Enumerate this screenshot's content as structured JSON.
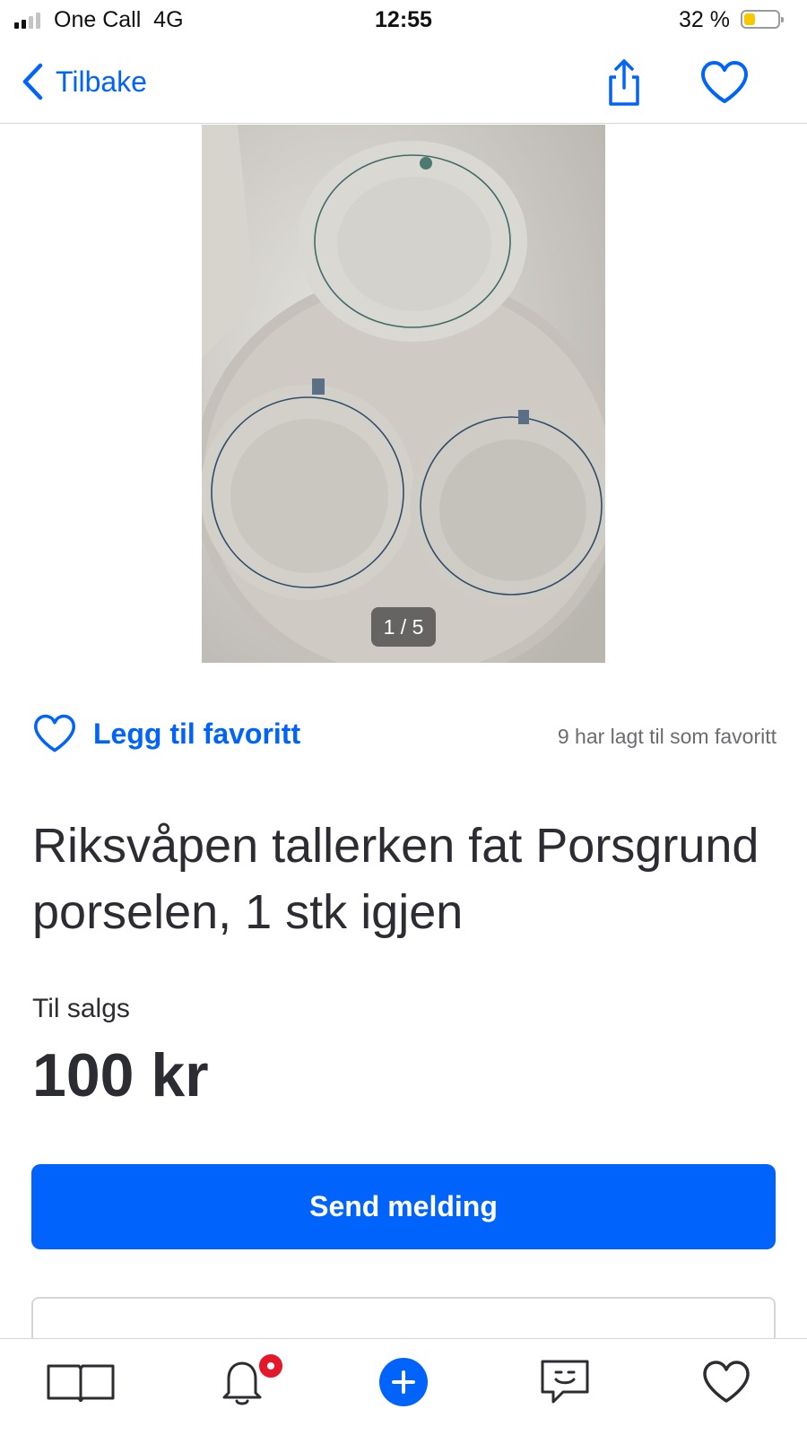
{
  "status_bar": {
    "carrier": "One Call",
    "network": "4G",
    "time": "12:55",
    "battery_percent": "32 %",
    "battery_level": 0.32,
    "signal_bars_active": 2,
    "signal_bars_total": 4
  },
  "nav": {
    "back_label": "Tilbake",
    "share_icon": "share-icon",
    "favorite_icon": "heart-outline-icon"
  },
  "gallery": {
    "counter": "1 / 5"
  },
  "favorite": {
    "add_label": "Legg til favoritt",
    "count_text": "9 har lagt til som favoritt"
  },
  "listing": {
    "title": "Riksvåpen tallerken fat Porsgrund porselen, 1 stk igjen",
    "sale_type": "Til salgs",
    "price": "100 kr"
  },
  "actions": {
    "send_label": "Send melding"
  },
  "tab_bar": {
    "items": [
      {
        "icon": "book-icon"
      },
      {
        "icon": "bell-icon",
        "has_badge": true
      },
      {
        "icon": "plus-circle-icon"
      },
      {
        "icon": "chat-smile-icon"
      },
      {
        "icon": "heart-outline-icon"
      }
    ]
  },
  "colors": {
    "accent": "#0063fb",
    "text": "#2c2c33",
    "muted": "#6b6b73",
    "badge": "#e4172b",
    "battery": "#f7c800"
  }
}
